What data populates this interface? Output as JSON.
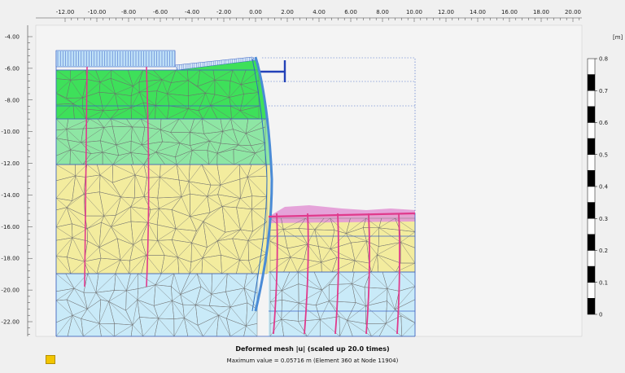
{
  "view": {
    "x_ticks": [
      "-12.00",
      "-10.00",
      "-8.00",
      "-6.00",
      "-4.00",
      "-2.00",
      "0.00",
      "2.00",
      "4.00",
      "6.00",
      "8.00",
      "10.00",
      "12.00",
      "14.00",
      "16.00",
      "18.00",
      "20.00"
    ],
    "y_ticks": [
      "-4.00",
      "-6.00",
      "-8.00",
      "-10.00",
      "-12.00",
      "-14.00",
      "-16.00",
      "-18.00",
      "-20.00",
      "-22.00"
    ],
    "unit_label": "[m]",
    "scale_labels": [
      "0.8",
      "0.7",
      "0.6",
      "0.5",
      "0.4",
      "0.3",
      "0.2",
      "0.1",
      "0"
    ],
    "colors": {
      "layer_green": "#3ee05a",
      "layer_light_green": "#8ee6a4",
      "layer_yellow": "#f3ec9e",
      "layer_blue": "#c9eaf8",
      "wall": "#4a8bd6",
      "pile": "#e03a8c",
      "anchor": "#2342b8",
      "plot_bg": "#f4f4f4"
    },
    "icons": [
      "legend-swatch-icon"
    ]
  },
  "caption": {
    "title": "Deformed mesh |u| (scaled up 20.0 times)",
    "subtitle": "Maximum value = 0.05716 m (Element 360 at Node 11904)"
  }
}
